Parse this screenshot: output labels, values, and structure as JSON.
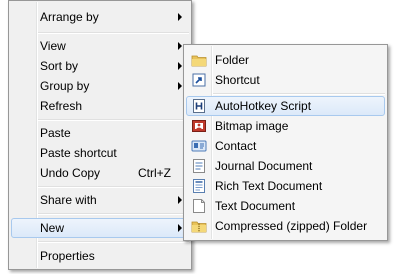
{
  "context_menu": {
    "items": [
      {
        "label": "Arrange by",
        "has_submenu": true
      },
      {
        "label": "View",
        "has_submenu": true
      },
      {
        "label": "Sort by",
        "has_submenu": true
      },
      {
        "label": "Group by",
        "has_submenu": true
      },
      {
        "label": "Refresh"
      },
      {
        "label": "Paste"
      },
      {
        "label": "Paste shortcut"
      },
      {
        "label": "Undo Copy",
        "shortcut": "Ctrl+Z"
      },
      {
        "label": "Share with",
        "has_submenu": true
      },
      {
        "label": "New",
        "has_submenu": true,
        "highlighted": true
      },
      {
        "label": "Properties"
      }
    ]
  },
  "new_submenu": {
    "items": [
      {
        "label": "Folder",
        "icon": "folder-icon"
      },
      {
        "label": "Shortcut",
        "icon": "shortcut-icon"
      },
      {
        "label": "AutoHotkey Script",
        "icon": "autohotkey-icon",
        "highlighted": true
      },
      {
        "label": "Bitmap image",
        "icon": "bitmap-icon"
      },
      {
        "label": "Contact",
        "icon": "contact-icon"
      },
      {
        "label": "Journal Document",
        "icon": "journal-icon"
      },
      {
        "label": "Rich Text Document",
        "icon": "rich-text-icon"
      },
      {
        "label": "Text Document",
        "icon": "text-document-icon"
      },
      {
        "label": "Compressed (zipped) Folder",
        "icon": "zip-folder-icon"
      }
    ]
  },
  "colors": {
    "menu_background": "#f0f0f0",
    "highlight_border": "#a8c9ee",
    "highlight_fill": "#dce9f9"
  }
}
